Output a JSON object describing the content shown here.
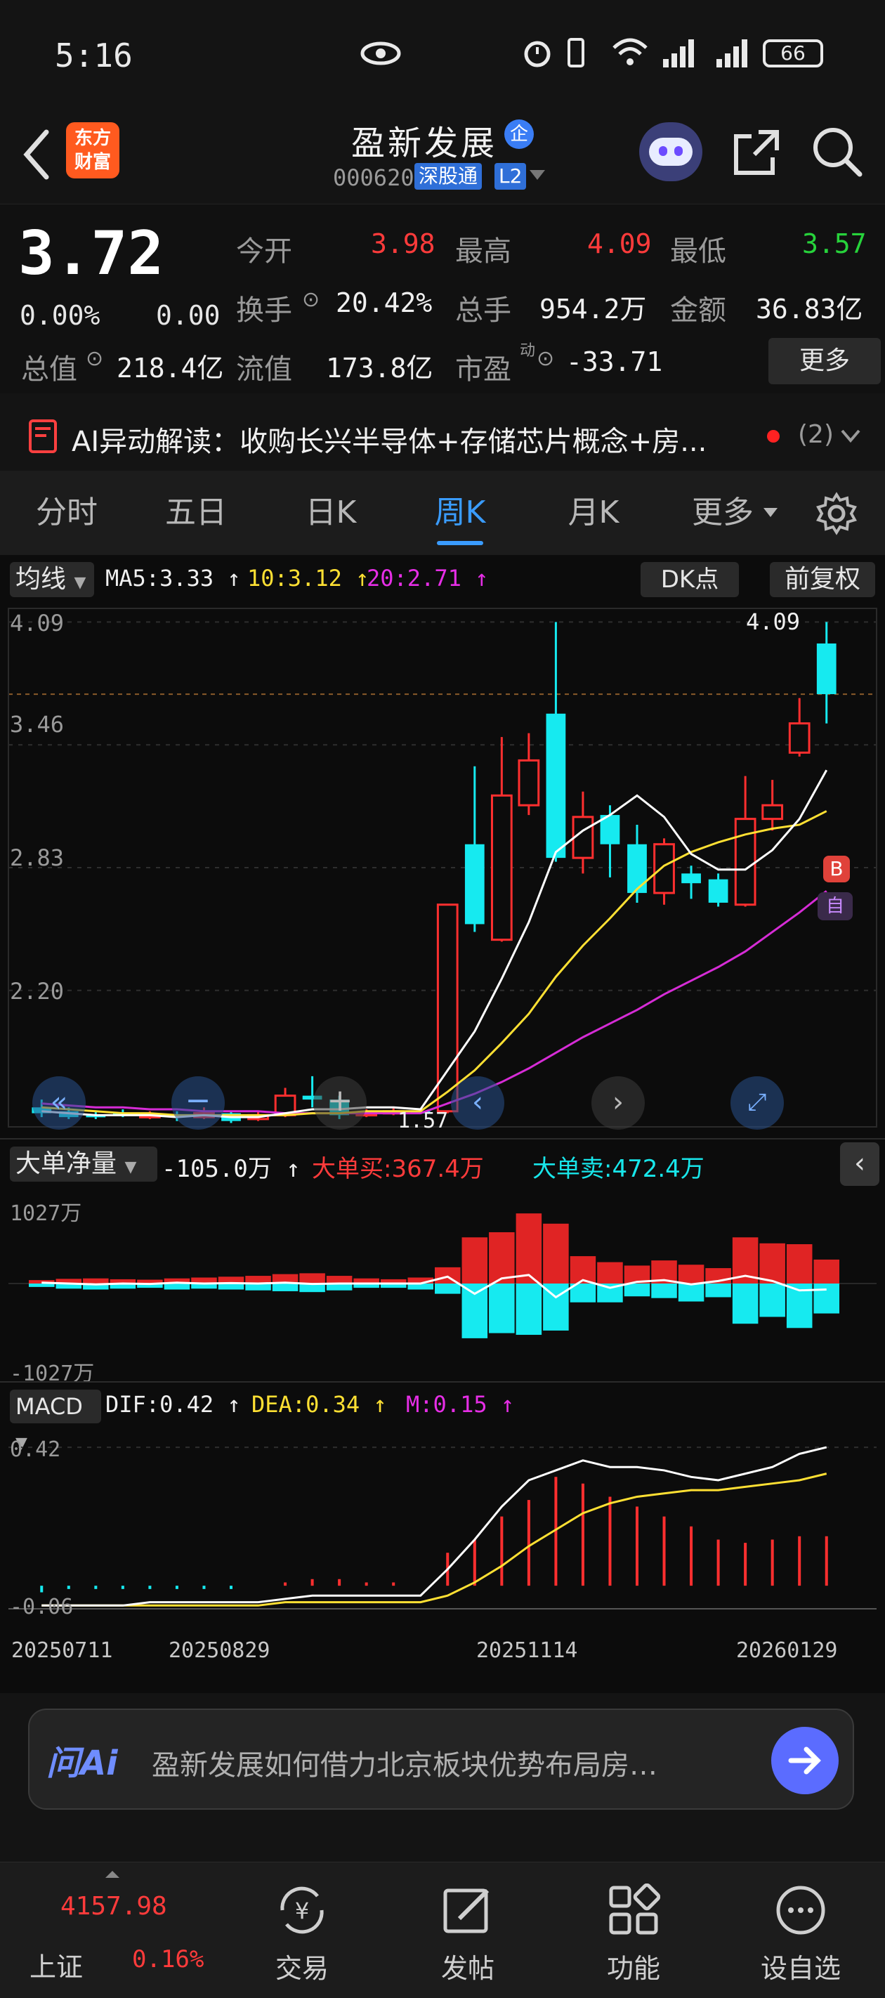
{
  "status_bar": {
    "time": "5:16",
    "battery": "66"
  },
  "header": {
    "back_label": "<",
    "app_logo": "东方\n财富",
    "stock_name": "盈新发展",
    "badge": "企",
    "code": "000620",
    "market": "深股通",
    "level": "L2"
  },
  "quote": {
    "price": "3.72",
    "change_pct": "0.00%",
    "change": "0.00",
    "open_label": "今开",
    "open": "3.98",
    "high_label": "最高",
    "high": "4.09",
    "low_label": "最低",
    "low": "3.57",
    "turnover_label": "换手",
    "turnover": "20.42%",
    "volume_label": "总手",
    "volume": "954.2万",
    "amount_label": "金额",
    "amount": "36.83亿",
    "total_cap_label": "总值",
    "total_cap": "218.4亿",
    "float_cap_label": "流值",
    "float_cap": "173.8亿",
    "pe_label": "市盈",
    "pe_super": "动",
    "pe": "-33.71",
    "more": "更多"
  },
  "ai_bar": {
    "text": "AI异动解读：收购长兴半导体+存储芯片概念+房...",
    "count": "(2)"
  },
  "tabs": [
    "分时",
    "五日",
    "日K",
    "周K",
    "月K",
    "更多"
  ],
  "active_tab": 3,
  "ma_bar": {
    "selector": "均线",
    "ma5": "MA5:3.33 ↑",
    "ma10": "10:3.12 ↑",
    "ma20": "20:2.71 ↑",
    "dk": "DK点",
    "adjust": "前复权"
  },
  "kline": {
    "y_labels": [
      "4.09",
      "3.46",
      "2.83",
      "2.20"
    ],
    "max_marker": "4.09",
    "low_marker": "1.57",
    "b_marker": "B",
    "self_marker": "自"
  },
  "big_order": {
    "selector": "大单净量",
    "net": "-105.0万 ↑",
    "buy": "大单买:367.4万",
    "sell": "大单卖:472.4万",
    "top": "1027万",
    "bottom": "-1027万"
  },
  "macd": {
    "selector": "MACD",
    "dif": "DIF:0.42 ↑",
    "dea": "DEA:0.34 ↑",
    "m": "M:0.15 ↑",
    "top": "0.42",
    "bottom": "-0.06"
  },
  "x_axis": [
    "20250711",
    "20250829",
    "20251114",
    "20260129"
  ],
  "ask_ai": {
    "logo": "问Ai",
    "text": "盈新发展如何借力北京板块优势布局房…"
  },
  "bottom_nav": {
    "index_value": "4157.98",
    "index_name": "上证",
    "index_pct": "0.16%",
    "items": [
      "交易",
      "发帖",
      "功能",
      "设自选"
    ]
  },
  "chart_data": {
    "type": "candlestick",
    "candles": [
      {
        "o": 1.6,
        "c": 1.57,
        "h": 1.64,
        "l": 1.55
      },
      {
        "o": 1.58,
        "c": 1.55,
        "h": 1.6,
        "l": 1.54
      },
      {
        "o": 1.56,
        "c": 1.55,
        "h": 1.58,
        "l": 1.54
      },
      {
        "o": 1.57,
        "c": 1.56,
        "h": 1.59,
        "l": 1.55
      },
      {
        "o": 1.55,
        "c": 1.56,
        "h": 1.58,
        "l": 1.54
      },
      {
        "o": 1.56,
        "c": 1.55,
        "h": 1.58,
        "l": 1.53
      },
      {
        "o": 1.55,
        "c": 1.57,
        "h": 1.6,
        "l": 1.54
      },
      {
        "o": 1.57,
        "c": 1.53,
        "h": 1.58,
        "l": 1.52
      },
      {
        "o": 1.54,
        "c": 1.56,
        "h": 1.58,
        "l": 1.53
      },
      {
        "o": 1.56,
        "c": 1.66,
        "h": 1.7,
        "l": 1.55
      },
      {
        "o": 1.66,
        "c": 1.64,
        "h": 1.76,
        "l": 1.6
      },
      {
        "o": 1.64,
        "c": 1.56,
        "h": 1.66,
        "l": 1.54
      },
      {
        "o": 1.56,
        "c": 1.57,
        "h": 1.59,
        "l": 1.55
      },
      {
        "o": 1.57,
        "c": 1.58,
        "h": 1.6,
        "l": 1.56
      },
      {
        "o": 1.58,
        "c": 1.57,
        "h": 1.59,
        "l": 1.57
      },
      {
        "o": 1.58,
        "c": 2.64,
        "h": 2.64,
        "l": 1.57
      },
      {
        "o": 2.95,
        "c": 2.54,
        "h": 3.35,
        "l": 2.5
      },
      {
        "o": 2.46,
        "c": 3.2,
        "h": 3.5,
        "l": 2.45
      },
      {
        "o": 3.15,
        "c": 3.38,
        "h": 3.52,
        "l": 3.1
      },
      {
        "o": 3.62,
        "c": 2.88,
        "h": 4.09,
        "l": 2.86
      },
      {
        "o": 2.88,
        "c": 3.09,
        "h": 3.22,
        "l": 2.8
      },
      {
        "o": 3.1,
        "c": 2.95,
        "h": 3.15,
        "l": 2.78
      },
      {
        "o": 2.95,
        "c": 2.7,
        "h": 3.05,
        "l": 2.65
      },
      {
        "o": 2.7,
        "c": 2.95,
        "h": 2.98,
        "l": 2.64
      },
      {
        "o": 2.8,
        "c": 2.75,
        "h": 2.84,
        "l": 2.67
      },
      {
        "o": 2.77,
        "c": 2.65,
        "h": 2.8,
        "l": 2.63
      },
      {
        "o": 2.64,
        "c": 3.08,
        "h": 3.3,
        "l": 2.63
      },
      {
        "o": 3.08,
        "c": 3.15,
        "h": 3.28,
        "l": 3.02
      },
      {
        "o": 3.42,
        "c": 3.57,
        "h": 3.7,
        "l": 3.4
      },
      {
        "o": 3.98,
        "c": 3.72,
        "h": 4.09,
        "l": 3.57
      }
    ],
    "ma5": [
      1.58,
      1.57,
      1.56,
      1.56,
      1.56,
      1.55,
      1.56,
      1.55,
      1.55,
      1.57,
      1.59,
      1.59,
      1.6,
      1.6,
      1.59,
      1.79,
      1.99,
      2.26,
      2.55,
      2.91,
      3.02,
      3.1,
      3.2,
      3.09,
      2.9,
      2.82,
      2.82,
      2.92,
      3.08,
      3.33
    ],
    "ma10": [
      1.6,
      1.59,
      1.58,
      1.57,
      1.57,
      1.56,
      1.56,
      1.56,
      1.56,
      1.56,
      1.57,
      1.57,
      1.58,
      1.58,
      1.58,
      1.68,
      1.79,
      1.93,
      2.08,
      2.27,
      2.43,
      2.57,
      2.72,
      2.84,
      2.91,
      2.96,
      3.0,
      3.03,
      3.05,
      3.12
    ],
    "ma20": [
      1.62,
      1.61,
      1.6,
      1.6,
      1.59,
      1.59,
      1.58,
      1.58,
      1.58,
      1.57,
      1.57,
      1.57,
      1.57,
      1.57,
      1.57,
      1.62,
      1.67,
      1.73,
      1.8,
      1.88,
      1.96,
      2.03,
      2.1,
      2.18,
      2.25,
      2.32,
      2.4,
      2.5,
      2.6,
      2.71
    ],
    "ylim": [
      1.5,
      4.16
    ],
    "big_order_net": [
      {
        "b": 40,
        "s": -40,
        "n": 10
      },
      {
        "b": 55,
        "s": -60,
        "n": 0
      },
      {
        "b": 60,
        "s": -70,
        "n": -10
      },
      {
        "b": 50,
        "s": -60,
        "n": 0
      },
      {
        "b": 45,
        "s": -50,
        "n": -5
      },
      {
        "b": 60,
        "s": -70,
        "n": 10
      },
      {
        "b": 70,
        "s": -60,
        "n": 0
      },
      {
        "b": 80,
        "s": -70,
        "n": 5
      },
      {
        "b": 90,
        "s": -80,
        "n": 0
      },
      {
        "b": 110,
        "s": -90,
        "n": 10
      },
      {
        "b": 120,
        "s": -100,
        "n": -5
      },
      {
        "b": 90,
        "s": -80,
        "n": 0
      },
      {
        "b": 60,
        "s": -50,
        "n": 0
      },
      {
        "b": 50,
        "s": -50,
        "n": 0
      },
      {
        "b": 70,
        "s": -70,
        "n": 0
      },
      {
        "b": 190,
        "s": -120,
        "n": 80
      },
      {
        "b": 540,
        "s": -640,
        "n": -120
      },
      {
        "b": 600,
        "s": -580,
        "n": 60
      },
      {
        "b": 820,
        "s": -600,
        "n": 100
      },
      {
        "b": 700,
        "s": -550,
        "n": -160
      },
      {
        "b": 320,
        "s": -220,
        "n": 40
      },
      {
        "b": 250,
        "s": -220,
        "n": -50
      },
      {
        "b": 210,
        "s": -150,
        "n": 20
      },
      {
        "b": 270,
        "s": -170,
        "n": 40
      },
      {
        "b": 220,
        "s": -210,
        "n": -10
      },
      {
        "b": 180,
        "s": -160,
        "n": 30
      },
      {
        "b": 540,
        "s": -470,
        "n": 90
      },
      {
        "b": 470,
        "s": -390,
        "n": 30
      },
      {
        "b": 460,
        "s": -520,
        "n": -80
      },
      {
        "b": 280,
        "s": -350,
        "n": -70
      }
    ],
    "big_order_range": [
      -1027,
      1027
    ],
    "macd_m": [
      -0.02,
      -0.01,
      -0.01,
      -0.01,
      -0.01,
      -0.01,
      -0.01,
      -0.01,
      0.0,
      0.01,
      0.02,
      0.02,
      0.01,
      0.01,
      0.0,
      0.1,
      0.14,
      0.21,
      0.26,
      0.33,
      0.31,
      0.27,
      0.24,
      0.21,
      0.18,
      0.14,
      0.13,
      0.14,
      0.15,
      0.15
    ],
    "macd_dif": [
      -0.06,
      -0.06,
      -0.06,
      -0.06,
      -0.05,
      -0.05,
      -0.05,
      -0.05,
      -0.05,
      -0.04,
      -0.03,
      -0.03,
      -0.03,
      -0.03,
      -0.03,
      0.05,
      0.14,
      0.24,
      0.32,
      0.35,
      0.38,
      0.36,
      0.36,
      0.35,
      0.33,
      0.32,
      0.34,
      0.36,
      0.4,
      0.42
    ],
    "macd_dea": [
      -0.06,
      -0.06,
      -0.06,
      -0.06,
      -0.06,
      -0.06,
      -0.06,
      -0.06,
      -0.06,
      -0.05,
      -0.05,
      -0.05,
      -0.05,
      -0.05,
      -0.05,
      -0.03,
      0.01,
      0.06,
      0.12,
      0.17,
      0.22,
      0.25,
      0.27,
      0.28,
      0.29,
      0.29,
      0.3,
      0.31,
      0.32,
      0.34
    ],
    "macd_range": [
      -0.07,
      0.45
    ]
  }
}
